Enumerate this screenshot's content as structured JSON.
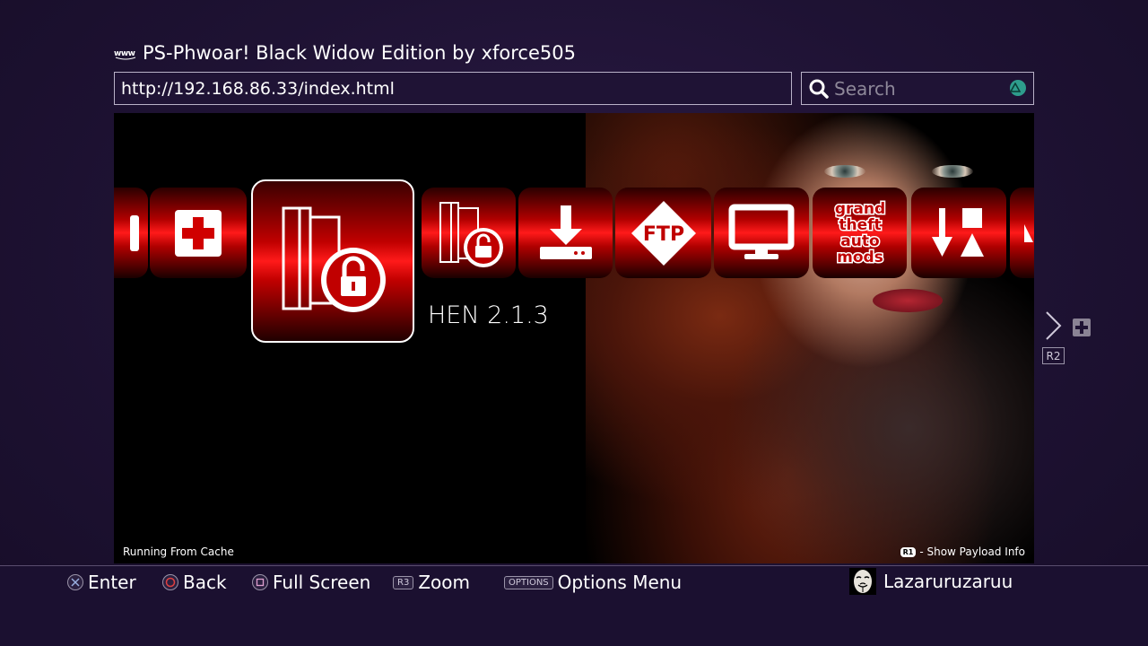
{
  "header": {
    "site_icon": "www-icon",
    "title": "PS-Phwoar! Black Widow Edition by xforce505"
  },
  "address_bar": {
    "url": "http://192.168.86.33/index.html"
  },
  "search": {
    "placeholder": "Search",
    "button_icon": "triangle-icon"
  },
  "payload_tiles": [
    {
      "icon": "partial-tile-icon"
    },
    {
      "icon": "plus-icon"
    },
    {
      "icon": "console-unlock-icon",
      "label": "HEN 2.1.3",
      "focused": true
    },
    {
      "icon": "console-unlock-small-icon"
    },
    {
      "icon": "download-icon"
    },
    {
      "icon": "ftp-icon",
      "text": "FTP"
    },
    {
      "icon": "monitor-icon"
    },
    {
      "icon": "gta-mods-icon",
      "text": [
        "grand",
        "theft",
        "auto",
        "mods"
      ]
    },
    {
      "icon": "arrow-shapes-icon"
    },
    {
      "icon": "partial-tile-icon"
    }
  ],
  "focused_label": "HEN 2.1.3",
  "status": {
    "left": "Running From Cache",
    "right_badge": "R1",
    "right_text": "- Show Payload Info"
  },
  "side_nav": {
    "badge": "R2"
  },
  "button_hints": [
    {
      "button": "cross",
      "label": "Enter"
    },
    {
      "button": "circle",
      "label": "Back"
    },
    {
      "button": "square",
      "label": "Full Screen"
    },
    {
      "button": "R3",
      "label": "Zoom"
    },
    {
      "button": "OPTIONS",
      "label": "Options Menu"
    }
  ],
  "user": {
    "name": "Lazaruruzaruu",
    "avatar_icon": "anonymous-mask-icon"
  },
  "colors": {
    "accent_red": "#e00000",
    "background": "#1e1233",
    "triangle": "#2e9c8c",
    "circle": "#e04040"
  }
}
